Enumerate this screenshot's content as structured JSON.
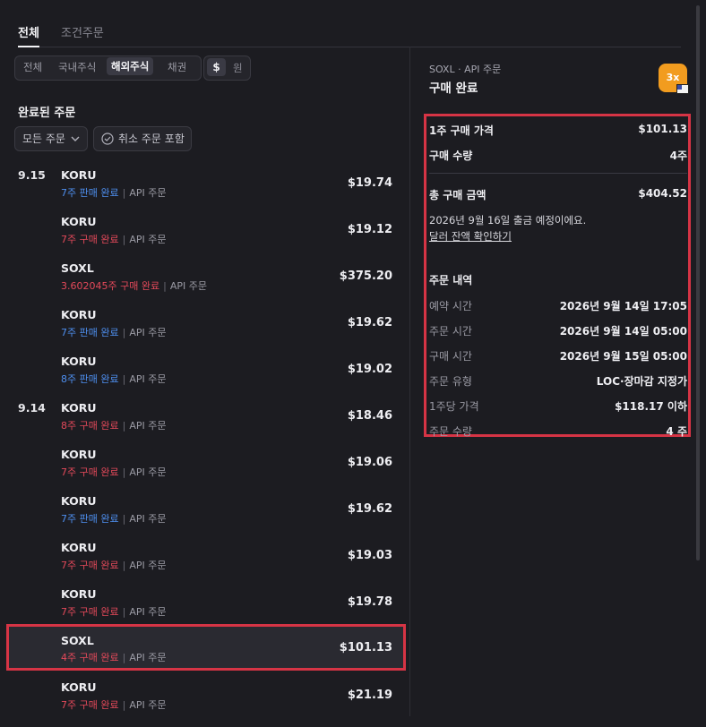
{
  "tabs": {
    "all": "전체",
    "conditional": "조건주문"
  },
  "market_filter": [
    "전체",
    "국내주식",
    "해외주식",
    "채권"
  ],
  "currency": {
    "dollar": "$",
    "won": "원"
  },
  "section_title": "완료된 주문",
  "filters": {
    "all_orders": "모든 주문",
    "include_cancelled": "취소 주문 포함"
  },
  "orders": [
    {
      "date": "9.15",
      "name": "KORU",
      "qty": "7주 판매 완료",
      "qty_color": "blue",
      "source": "API 주문",
      "price": "$19.74"
    },
    {
      "date": "",
      "name": "KORU",
      "qty": "7주 구매 완료",
      "qty_color": "red",
      "source": "API 주문",
      "price": "$19.12"
    },
    {
      "date": "",
      "name": "SOXL",
      "qty": "3.602045주 구매 완료",
      "qty_color": "red",
      "source": "API 주문",
      "price": "$375.20"
    },
    {
      "date": "",
      "name": "KORU",
      "qty": "7주 판매 완료",
      "qty_color": "blue",
      "source": "API 주문",
      "price": "$19.62"
    },
    {
      "date": "",
      "name": "KORU",
      "qty": "8주 판매 완료",
      "qty_color": "blue",
      "source": "API 주문",
      "price": "$19.02"
    },
    {
      "date": "9.14",
      "name": "KORU",
      "qty": "8주 구매 완료",
      "qty_color": "red",
      "source": "API 주문",
      "price": "$18.46"
    },
    {
      "date": "",
      "name": "KORU",
      "qty": "7주 구매 완료",
      "qty_color": "red",
      "source": "API 주문",
      "price": "$19.06"
    },
    {
      "date": "",
      "name": "KORU",
      "qty": "7주 판매 완료",
      "qty_color": "blue",
      "source": "API 주문",
      "price": "$19.62"
    },
    {
      "date": "",
      "name": "KORU",
      "qty": "7주 구매 완료",
      "qty_color": "red",
      "source": "API 주문",
      "price": "$19.03"
    },
    {
      "date": "",
      "name": "KORU",
      "qty": "7주 구매 완료",
      "qty_color": "red",
      "source": "API 주문",
      "price": "$19.78"
    },
    {
      "date": "",
      "name": "SOXL",
      "qty": "4주 구매 완료",
      "qty_color": "red",
      "source": "API 주문",
      "price": "$101.13",
      "selected": true
    },
    {
      "date": "",
      "name": "KORU",
      "qty": "7주 구매 완료",
      "qty_color": "red",
      "source": "API 주문",
      "price": "$21.19"
    }
  ],
  "detail": {
    "meta": "SOXL · API 주문",
    "title": "구매 완료",
    "badge": "3x",
    "price_label": "1주 구매 가격",
    "price": "$101.13",
    "qty_label": "구매 수량",
    "qty": "4주",
    "total_label": "총 구매 금액",
    "total": "$404.52",
    "note": "2026년 9월 16일 출금 예정이에요.",
    "link": "달러 잔액 확인하기",
    "history_title": "주문 내역",
    "history": [
      {
        "label": "예약 시간",
        "value": "2026년 9월 14일 17:05"
      },
      {
        "label": "주문 시간",
        "value": "2026년 9월 14일 05:00"
      },
      {
        "label": "구매 시간",
        "value": "2026년 9월 15일 05:00"
      },
      {
        "label": "주문 유형",
        "value": "LOC·장마감 지정가"
      },
      {
        "label": "1주당 가격",
        "value": "$118.17 이하"
      },
      {
        "label": "주문 수량",
        "value": "4 주"
      }
    ]
  },
  "colors": {
    "accent_red": "#d63445",
    "buy_red": "#e4495a",
    "sell_blue": "#4e8ff0",
    "badge_orange": "#f29c1f"
  }
}
